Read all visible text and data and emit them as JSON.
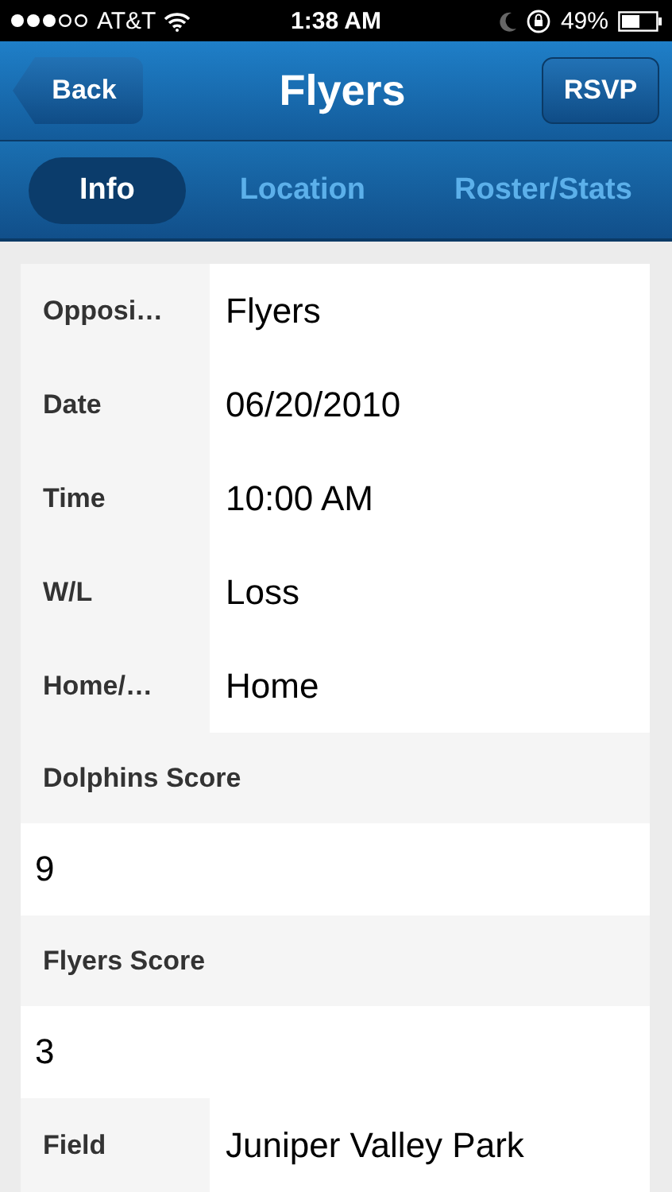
{
  "status_bar": {
    "carrier": "AT&T",
    "time": "1:38 AM",
    "battery": "49%"
  },
  "nav_bar": {
    "back": "Back",
    "title": "Flyers",
    "action": "RSVP"
  },
  "tabs": [
    {
      "label": "Info",
      "selected": true
    },
    {
      "label": "Location",
      "selected": false
    },
    {
      "label": "Roster/Stats",
      "selected": false
    }
  ],
  "rows": [
    {
      "kind": "inline",
      "label": "Opposi…",
      "value": "Flyers"
    },
    {
      "kind": "inline",
      "label": "Date",
      "value": "06/20/2010"
    },
    {
      "kind": "inline",
      "label": "Time",
      "value": "10:00 AM"
    },
    {
      "kind": "inline",
      "label": "W/L",
      "value": "Loss"
    },
    {
      "kind": "inline",
      "label": "Home/…",
      "value": "Home"
    },
    {
      "kind": "stacked",
      "label": "Dolphins Score",
      "value": "9"
    },
    {
      "kind": "stacked",
      "label": "Flyers Score",
      "value": "3"
    },
    {
      "kind": "inline",
      "label": "Field",
      "value": "Juniper Valley Park"
    }
  ]
}
